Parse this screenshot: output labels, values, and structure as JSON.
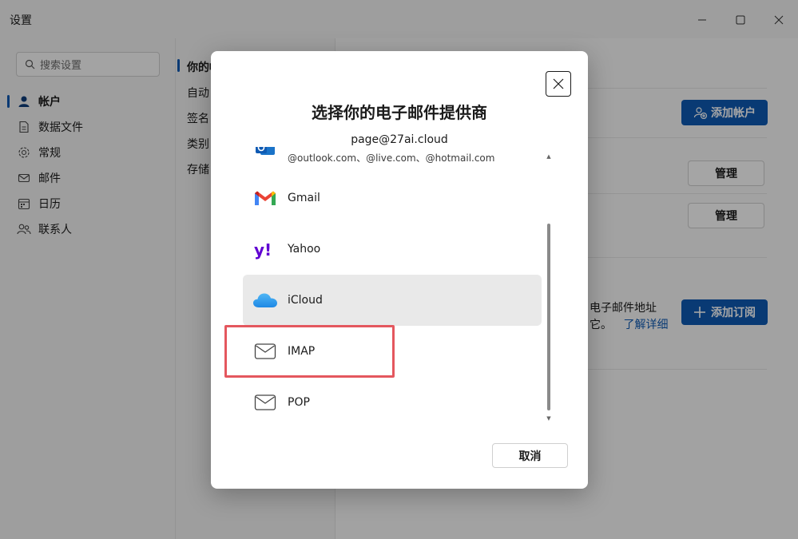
{
  "window": {
    "title": "设置"
  },
  "search": {
    "placeholder": "搜索设置"
  },
  "nav": {
    "items": [
      {
        "label": "帐户",
        "icon": "person-icon",
        "active": true
      },
      {
        "label": "数据文件",
        "icon": "file-icon",
        "active": false
      },
      {
        "label": "常规",
        "icon": "gear-icon",
        "active": false
      },
      {
        "label": "邮件",
        "icon": "mail-icon",
        "active": false
      },
      {
        "label": "日历",
        "icon": "calendar-icon",
        "active": false
      },
      {
        "label": "联系人",
        "icon": "people-icon",
        "active": false
      }
    ]
  },
  "middle": {
    "items": [
      "你的帐",
      "自动",
      "签名",
      "类别",
      "存储"
    ]
  },
  "right": {
    "add_account": "添加帐户",
    "manage1": "管理",
    "manage2": "管理",
    "info_line1": "电子邮件地址",
    "info_line2": "它。",
    "learn_more": "了解详细",
    "add_subscription": "添加订阅"
  },
  "dialog": {
    "title": "选择你的电子邮件提供商",
    "email": "page@27ai.cloud",
    "outlook_domains": "@outlook.com、@live.com、@hotmail.com",
    "providers": [
      {
        "name": "Gmail",
        "icon": "gmail-icon"
      },
      {
        "name": "Yahoo",
        "icon": "yahoo-icon"
      },
      {
        "name": "iCloud",
        "icon": "icloud-icon",
        "selected": true
      },
      {
        "name": "IMAP",
        "icon": "mail-envelope-icon"
      },
      {
        "name": "POP",
        "icon": "mail-envelope-icon"
      }
    ],
    "cancel": "取消"
  },
  "colors": {
    "accent": "#0f5ab3",
    "highlight": "#e4575e"
  }
}
